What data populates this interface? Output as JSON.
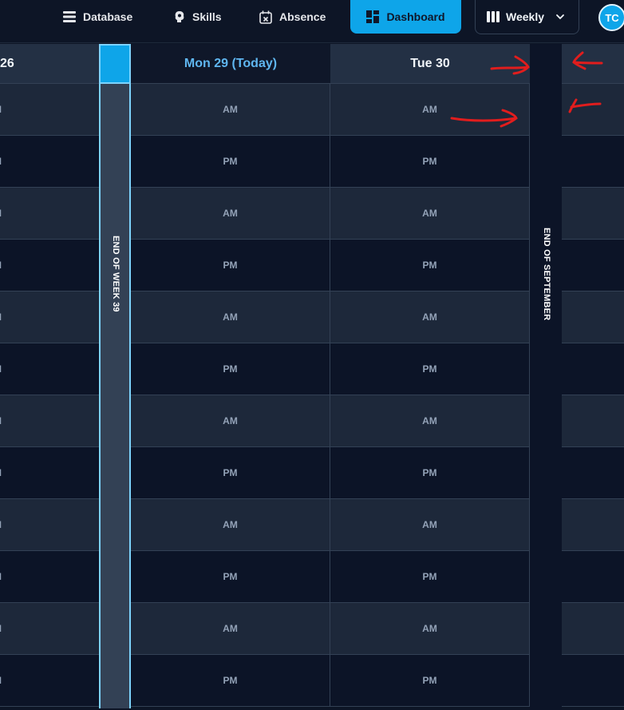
{
  "nav": {
    "items": [
      {
        "label": "Database",
        "icon": "database-icon"
      },
      {
        "label": "Skills",
        "icon": "brain-icon"
      },
      {
        "label": "Absence",
        "icon": "calendar-x-icon"
      },
      {
        "label": "Dashboard",
        "icon": "dashboard-icon",
        "active": true
      }
    ],
    "view_select": {
      "label": "Weekly",
      "icon": "columns-icon"
    },
    "avatar_initials": "TC",
    "accent_color": "#0ea5e9"
  },
  "columns": {
    "prev_label": "26",
    "mon_label": "Mon 29 (Today)",
    "tue_label": "Tue 30"
  },
  "markers": {
    "week": "END OF WEEK 39",
    "month": "END OF SEPTEMBER"
  },
  "slots": {
    "prev": [
      "M",
      "M",
      "M",
      "M",
      "M",
      "M",
      "M",
      "M",
      "M",
      "M",
      "M",
      "M"
    ],
    "mon": [
      "AM",
      "PM",
      "AM",
      "PM",
      "AM",
      "PM",
      "AM",
      "PM",
      "AM",
      "PM",
      "AM",
      "PM"
    ],
    "tue": [
      "AM",
      "PM",
      "AM",
      "PM",
      "AM",
      "PM",
      "AM",
      "PM",
      "AM",
      "PM",
      "AM",
      "PM"
    ]
  },
  "annotation_color": "#e11d1d"
}
